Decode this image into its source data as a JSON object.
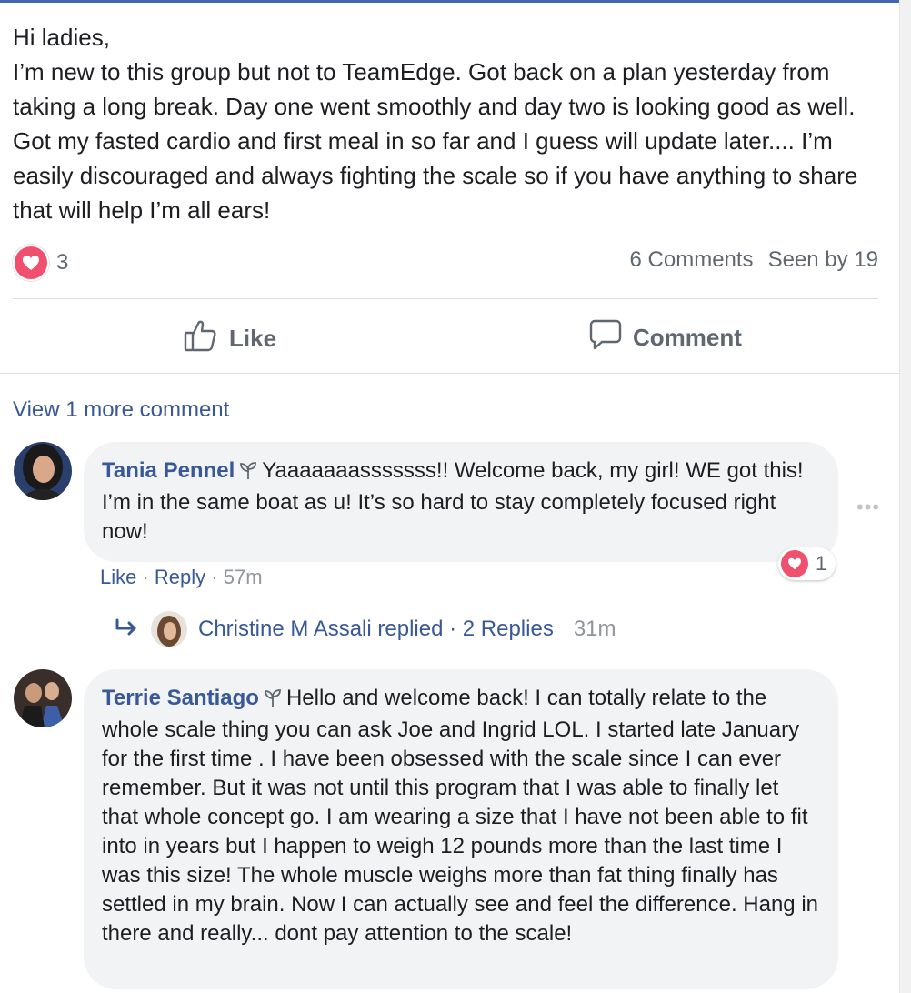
{
  "post": {
    "text": "Hi ladies,\nI’m new to this group but not to TeamEdge. Got back on a plan yesterday from taking a long break. Day one went smoothly and day two is looking good as well. Got my fasted cardio and first meal in so far and I guess will update later.... I’m easily discouraged and always fighting the scale so if you have anything to share that will help I’m all ears!",
    "reaction_count": "3",
    "comments_count": "6 Comments",
    "seen_by": "Seen by 19"
  },
  "actions": {
    "like_label": "Like",
    "comment_label": "Comment"
  },
  "view_more": "View 1 more comment",
  "comments": [
    {
      "author": "Tania Pennel",
      "text": "Yaaaaaaasssssss!! Welcome back, my girl! WE got this! I’m in the same boat as u! It’s so hard to stay completely focused right now!",
      "like": "Like",
      "reply": "Reply",
      "time": "57m",
      "reaction_count": "1",
      "more": "•••"
    },
    {
      "author": "Terrie Santiago",
      "text": "Hello and welcome back! I can totally relate to the whole scale thing you can ask Joe and Ingrid LOL. I started late January for the first time . I have been obsessed with the scale since I can ever remember. But it was not until this program that I was able to finally let that whole concept go. I am wearing a size that I have not been able to fit into in years but I happen to weigh 12 pounds more than the last time I was this size! The whole muscle weighs more than fat thing finally has settled in my brain. Now I can actually see and feel the difference. Hang in there and really... dont pay attention to the scale!"
    }
  ],
  "reply_summary": {
    "text": "Christine M Assali replied · 2 Replies",
    "time": "31m"
  },
  "colors": {
    "link": "#385898",
    "heart": "#f0506e",
    "bubble": "#f2f3f5",
    "muted": "#606770"
  }
}
